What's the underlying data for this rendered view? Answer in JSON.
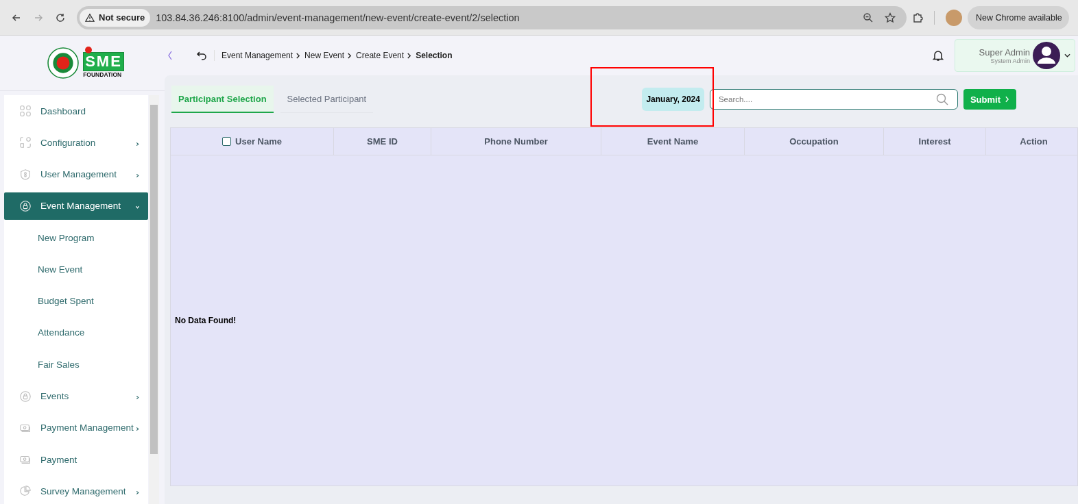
{
  "browser": {
    "security": "Not secure",
    "url": "103.84.36.246:8100/admin/event-management/new-event/create-event/2/selection",
    "update": "New Chrome available"
  },
  "logo": {
    "letters": "SME",
    "subtitle": "FOUNDATION"
  },
  "breadcrumb": [
    {
      "label": "Event Management",
      "current": false
    },
    {
      "label": "New Event",
      "current": false
    },
    {
      "label": "Create Event",
      "current": false
    },
    {
      "label": "Selection",
      "current": true
    }
  ],
  "user": {
    "name": "Super Admin",
    "role": "System Admin"
  },
  "sidebar": {
    "items": [
      {
        "label": "Dashboard",
        "kind": "link",
        "selected": false
      },
      {
        "label": "Configuration",
        "kind": "menu",
        "selected": false,
        "expanded": false
      },
      {
        "label": "User Management",
        "kind": "menu",
        "selected": false,
        "expanded": false
      },
      {
        "label": "Event Management",
        "kind": "menu",
        "selected": true,
        "expanded": true,
        "children": [
          {
            "label": "New Program"
          },
          {
            "label": "New Event"
          },
          {
            "label": "Budget Spent"
          },
          {
            "label": "Attendance"
          },
          {
            "label": "Fair Sales"
          }
        ]
      },
      {
        "label": "Events",
        "kind": "menu",
        "selected": false,
        "expanded": false
      },
      {
        "label": "Payment Management",
        "kind": "menu",
        "selected": false,
        "expanded": false
      },
      {
        "label": "Payment",
        "kind": "link",
        "selected": false
      },
      {
        "label": "Survey Management",
        "kind": "menu",
        "selected": false,
        "expanded": false
      }
    ]
  },
  "tabs": [
    {
      "label": "Participant Selection",
      "selected": true
    },
    {
      "label": "Selected Participant",
      "selected": false
    }
  ],
  "month": "January, 2024",
  "search": {
    "placeholder": "Search...."
  },
  "submit": "Submit",
  "table": {
    "select_all": {
      "checked": false
    },
    "columns": [
      "User Name",
      "SME ID",
      "Phone Number",
      "Event Name",
      "Occupation",
      "Interest",
      "Action"
    ],
    "empty": "No Data Found!"
  }
}
